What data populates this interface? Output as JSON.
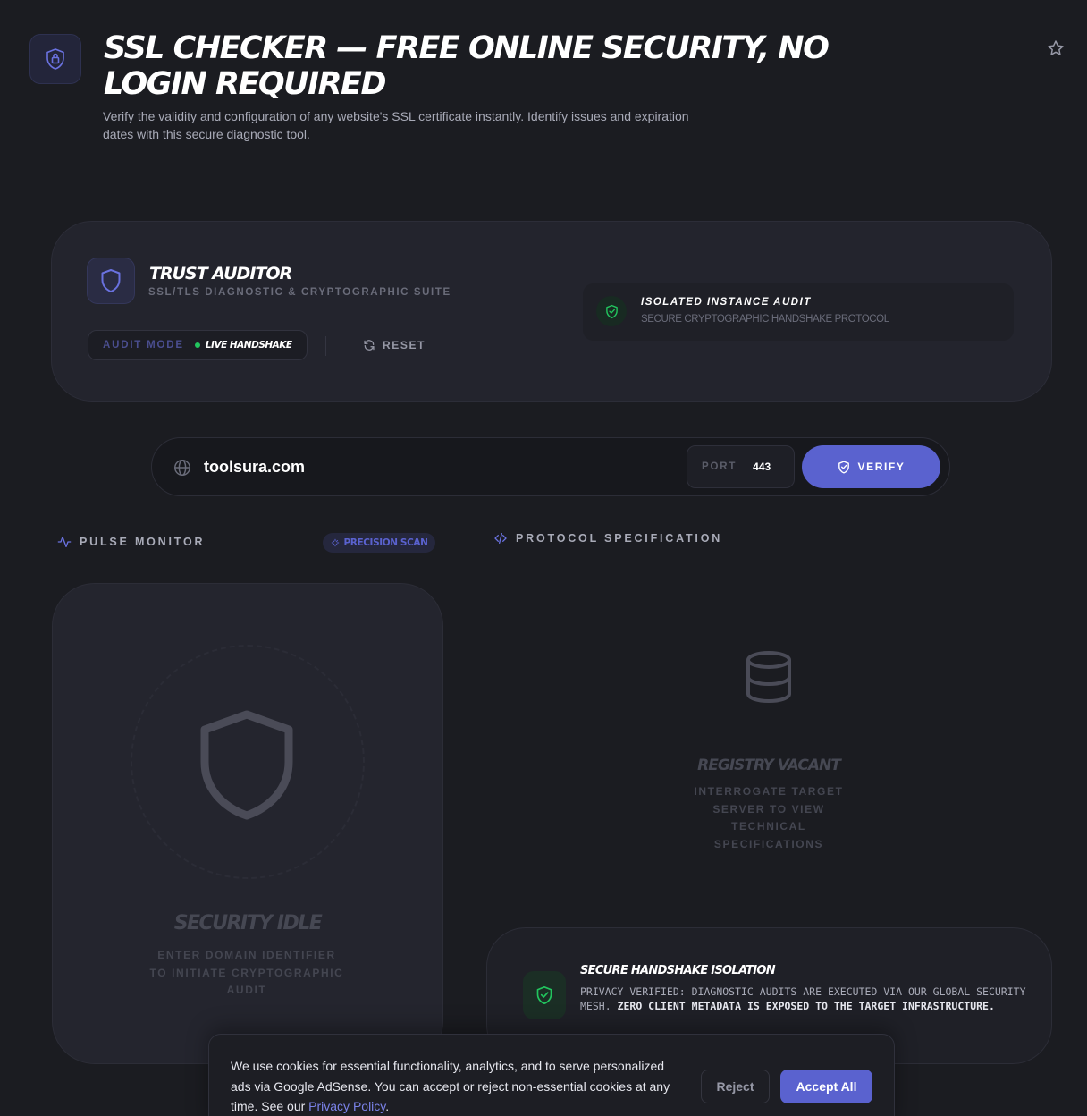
{
  "header": {
    "title": "SSL CHECKER — FREE ONLINE SECURITY, NO LOGIN REQUIRED",
    "description": "Verify the validity and configuration of any website's SSL certificate instantly. Identify issues and expiration dates with this secure diagnostic tool."
  },
  "auditor": {
    "title": "TRUST AUDITOR",
    "subtitle": "SSL/TLS DIAGNOSTIC & CRYPTOGRAPHIC SUITE",
    "audit_mode_label": "AUDIT MODE",
    "audit_mode_value": "LIVE HANDSHAKE",
    "reset_label": "RESET",
    "isolated_title": "ISOLATED INSTANCE AUDIT",
    "isolated_subtitle": "SECURE CRYPTOGRAPHIC HANDSHAKE PROTOCOL"
  },
  "search": {
    "domain_value": "toolsura.com",
    "port_label": "PORT",
    "port_value": "443",
    "verify_label": "VERIFY"
  },
  "pulse": {
    "section_label": "PULSE MONITOR",
    "badge": "PRECISION SCAN",
    "idle_title": "SECURITY IDLE",
    "idle_subtitle": "ENTER DOMAIN IDENTIFIER TO INITIATE CRYPTOGRAPHIC AUDIT"
  },
  "protocol": {
    "section_label": "PROTOCOL SPECIFICATION",
    "vacant_title": "REGISTRY VACANT",
    "vacant_subtitle": "INTERROGATE TARGET SERVER TO VIEW TECHNICAL SPECIFICATIONS"
  },
  "isolation": {
    "title": "SECURE HANDSHAKE ISOLATION",
    "text": "PRIVACY VERIFIED: DIAGNOSTIC AUDITS ARE EXECUTED VIA OUR GLOBAL SECURITY MESH.",
    "text_bold": "ZERO CLIENT METADATA IS EXPOSED TO THE TARGET INFRASTRUCTURE."
  },
  "cookie": {
    "text": "We use cookies for essential functionality, analytics, and to serve personalized ads via Google AdSense. You can accept or reject non-essential cookies at any time. See our",
    "link": "Privacy Policy",
    "after_link": ".",
    "reject_label": "Reject",
    "accept_label": "Accept All"
  },
  "icons": {
    "app": "lock-shield-icon",
    "favorite": "star-icon",
    "auditor": "shield-icon",
    "reset": "refresh-icon",
    "isolated": "shield-check-icon",
    "globe": "globe-icon",
    "verify": "shield-check-icon",
    "pulse": "activity-icon",
    "precision": "scan-icon",
    "protocol": "code-icon",
    "database": "database-icon"
  },
  "colors": {
    "accent": "#5a62cf",
    "success": "#22c55e",
    "background": "#1b1c21"
  }
}
